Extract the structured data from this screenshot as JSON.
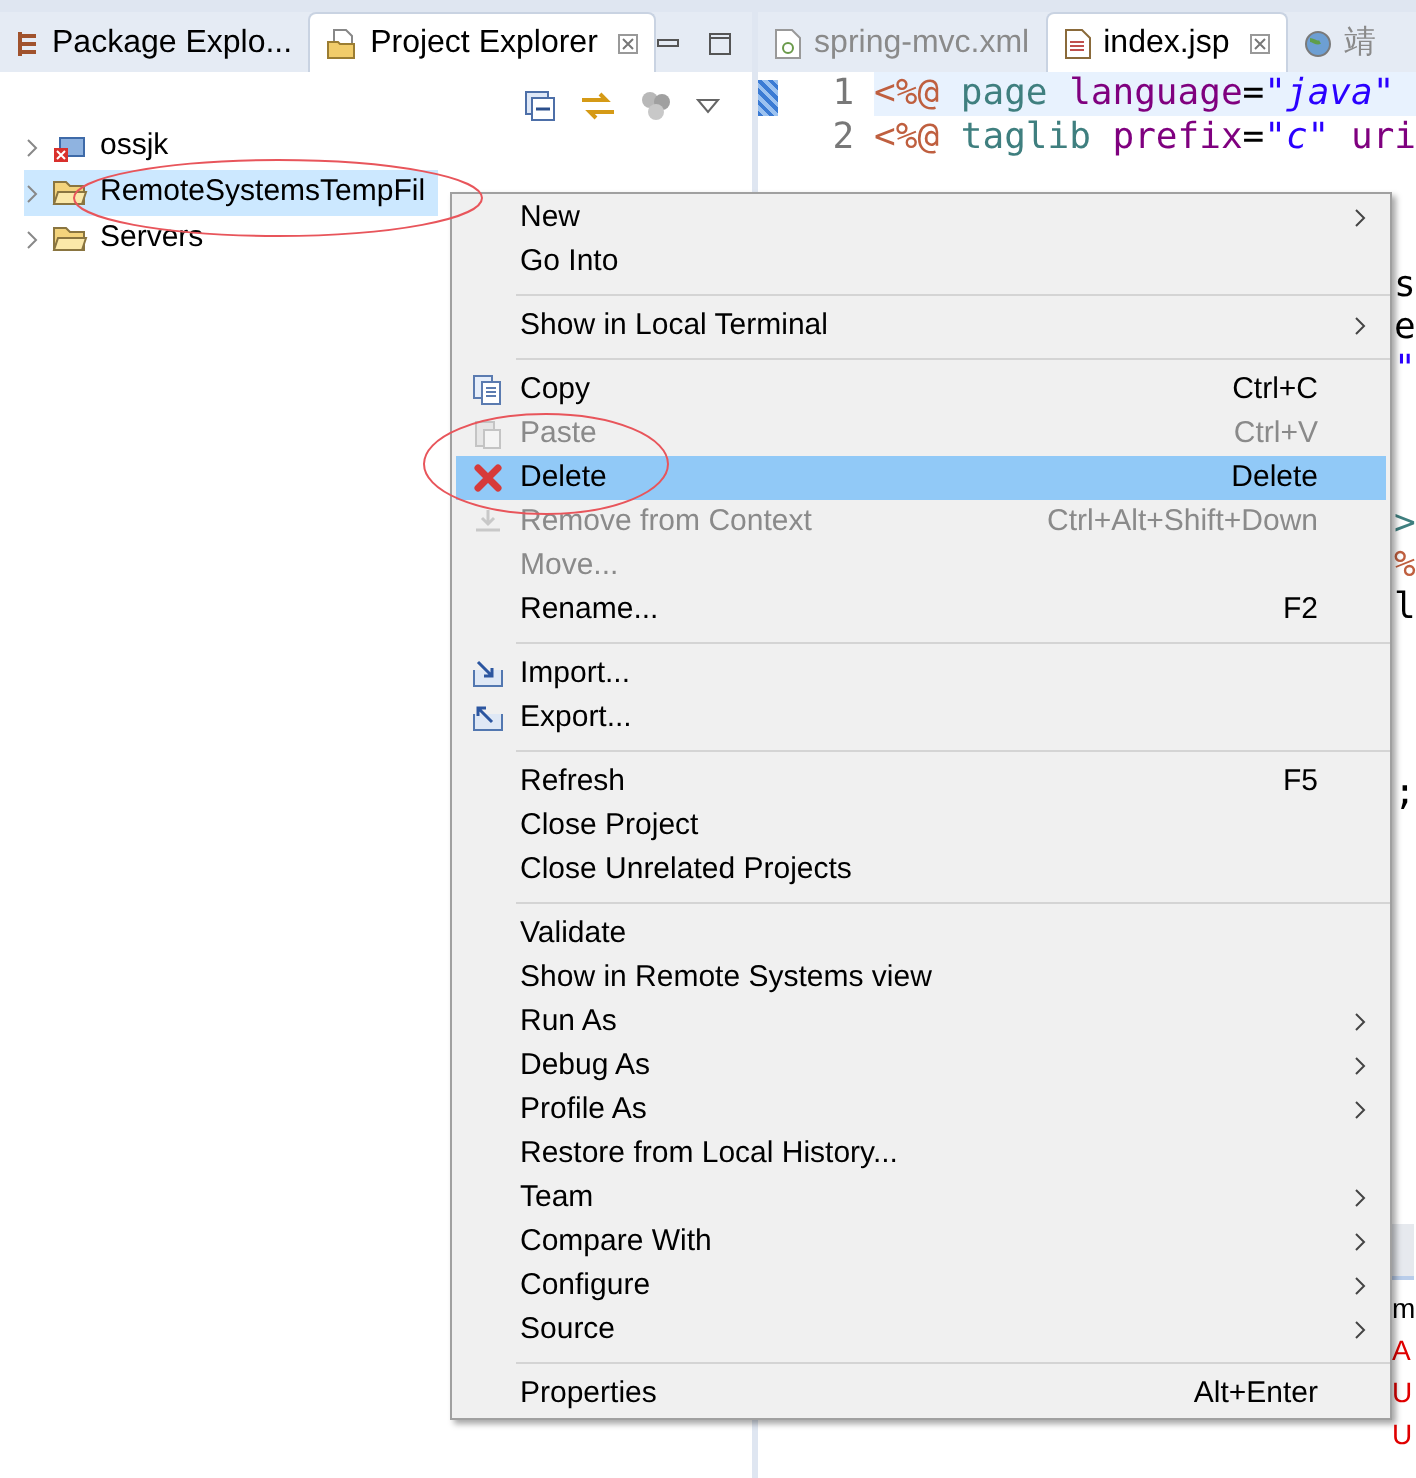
{
  "left_panel": {
    "tabs": [
      {
        "label": "Package Explo...",
        "selected": false,
        "closable": false
      },
      {
        "label": "Project Explorer",
        "selected": true,
        "closable": true
      }
    ],
    "tree": [
      {
        "label": "ossjk",
        "kind": "project",
        "selected": false
      },
      {
        "label": "RemoteSystemsTempFil",
        "kind": "folder",
        "selected": true
      },
      {
        "label": "Servers",
        "kind": "folder",
        "selected": false
      }
    ]
  },
  "editor": {
    "tabs": [
      {
        "label": "spring-mvc.xml",
        "selected": false,
        "closable": false
      },
      {
        "label": "index.jsp",
        "selected": true,
        "closable": true
      },
      {
        "label": "靖",
        "selected": false,
        "closable": false
      }
    ],
    "lines": [
      {
        "number": "1",
        "current": true,
        "tokens": [
          {
            "kind": "tag",
            "text": "<%@"
          },
          {
            "kind": "keyword",
            "text": " page"
          },
          {
            "kind": "attr",
            "text": " language"
          },
          {
            "kind": "plain",
            "text": "="
          },
          {
            "kind": "string",
            "text": "\"java\""
          }
        ]
      },
      {
        "number": "2",
        "current": false,
        "tokens": [
          {
            "kind": "tag",
            "text": "<%@"
          },
          {
            "kind": "keyword",
            "text": " taglib"
          },
          {
            "kind": "attr",
            "text": " prefix"
          },
          {
            "kind": "plain",
            "text": "="
          },
          {
            "kind": "string",
            "text": "\"c\""
          },
          {
            "kind": "attr",
            "text": " uri"
          }
        ]
      }
    ],
    "fragment_groups": [
      [
        {
          "kind": "plain",
          "text": "s"
        },
        {
          "kind": "plain",
          "text": "e"
        },
        {
          "kind": "string",
          "text": "\""
        }
      ],
      [
        {
          "kind": "keyword",
          "text": ">"
        },
        {
          "kind": "tag",
          "text": "%"
        },
        {
          "kind": "plain",
          "text": "l"
        }
      ],
      [
        {
          "kind": "plain",
          "text": ";"
        }
      ]
    ]
  },
  "bottom_panel": {
    "header": "m",
    "entries": [
      {
        "text": "A"
      },
      {
        "text": "U"
      },
      {
        "text": "U"
      }
    ]
  },
  "context_menu": [
    {
      "kind": "item",
      "label": "New",
      "submenu": true,
      "disabled": false,
      "selected": false
    },
    {
      "kind": "item",
      "label": "Go Into",
      "submenu": false,
      "disabled": false,
      "selected": false
    },
    {
      "kind": "separator"
    },
    {
      "kind": "item",
      "label": "Show in Local Terminal",
      "submenu": true,
      "disabled": false,
      "selected": false
    },
    {
      "kind": "separator"
    },
    {
      "kind": "item",
      "label": "Copy",
      "shortcut": "Ctrl+C",
      "submenu": false,
      "disabled": false,
      "selected": false
    },
    {
      "kind": "item",
      "label": "Paste",
      "shortcut": "Ctrl+V",
      "submenu": false,
      "disabled": true,
      "selected": false
    },
    {
      "kind": "item",
      "label": "Delete",
      "shortcut": "Delete",
      "submenu": false,
      "disabled": false,
      "selected": true
    },
    {
      "kind": "item",
      "label": "Remove from Context",
      "shortcut": "Ctrl+Alt+Shift+Down",
      "submenu": false,
      "disabled": true,
      "selected": false
    },
    {
      "kind": "item",
      "label": "Move...",
      "submenu": false,
      "disabled": true,
      "selected": false
    },
    {
      "kind": "item",
      "label": "Rename...",
      "shortcut": "F2",
      "submenu": false,
      "disabled": false,
      "selected": false
    },
    {
      "kind": "separator"
    },
    {
      "kind": "item",
      "label": "Import...",
      "submenu": false,
      "disabled": false,
      "selected": false
    },
    {
      "kind": "item",
      "label": "Export...",
      "submenu": false,
      "disabled": false,
      "selected": false
    },
    {
      "kind": "separator"
    },
    {
      "kind": "item",
      "label": "Refresh",
      "shortcut": "F5",
      "submenu": false,
      "disabled": false,
      "selected": false
    },
    {
      "kind": "item",
      "label": "Close Project",
      "submenu": false,
      "disabled": false,
      "selected": false
    },
    {
      "kind": "item",
      "label": "Close Unrelated Projects",
      "submenu": false,
      "disabled": false,
      "selected": false
    },
    {
      "kind": "separator"
    },
    {
      "kind": "item",
      "label": "Validate",
      "submenu": false,
      "disabled": false,
      "selected": false
    },
    {
      "kind": "item",
      "label": "Show in Remote Systems view",
      "submenu": false,
      "disabled": false,
      "selected": false
    },
    {
      "kind": "item",
      "label": "Run As",
      "submenu": true,
      "disabled": false,
      "selected": false
    },
    {
      "kind": "item",
      "label": "Debug As",
      "submenu": true,
      "disabled": false,
      "selected": false
    },
    {
      "kind": "item",
      "label": "Profile As",
      "submenu": true,
      "disabled": false,
      "selected": false
    },
    {
      "kind": "item",
      "label": "Restore from Local History...",
      "submenu": false,
      "disabled": false,
      "selected": false
    },
    {
      "kind": "item",
      "label": "Team",
      "submenu": true,
      "disabled": false,
      "selected": false
    },
    {
      "kind": "item",
      "label": "Compare With",
      "submenu": true,
      "disabled": false,
      "selected": false
    },
    {
      "kind": "item",
      "label": "Configure",
      "submenu": true,
      "disabled": false,
      "selected": false
    },
    {
      "kind": "item",
      "label": "Source",
      "submenu": true,
      "disabled": false,
      "selected": false
    },
    {
      "kind": "separator"
    },
    {
      "kind": "item",
      "label": "Properties",
      "shortcut": "Alt+Enter",
      "submenu": false,
      "disabled": false,
      "selected": false
    }
  ]
}
